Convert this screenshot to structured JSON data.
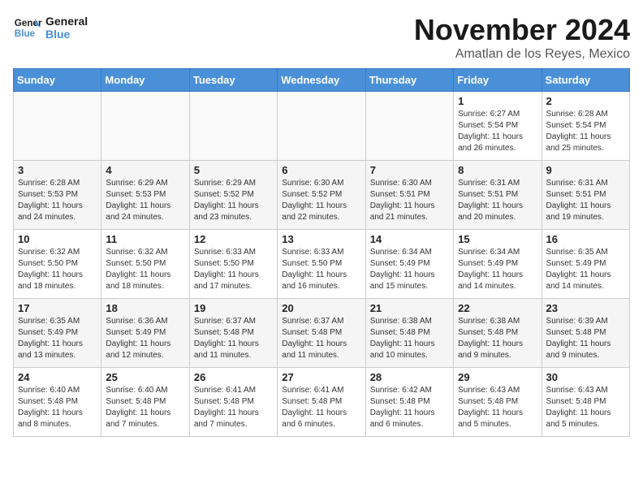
{
  "header": {
    "logo_line1": "General",
    "logo_line2": "Blue",
    "month": "November 2024",
    "location": "Amatlan de los Reyes, Mexico"
  },
  "days_of_week": [
    "Sunday",
    "Monday",
    "Tuesday",
    "Wednesday",
    "Thursday",
    "Friday",
    "Saturday"
  ],
  "weeks": [
    [
      {
        "num": "",
        "info": ""
      },
      {
        "num": "",
        "info": ""
      },
      {
        "num": "",
        "info": ""
      },
      {
        "num": "",
        "info": ""
      },
      {
        "num": "",
        "info": ""
      },
      {
        "num": "1",
        "info": "Sunrise: 6:27 AM\nSunset: 5:54 PM\nDaylight: 11 hours and 26 minutes."
      },
      {
        "num": "2",
        "info": "Sunrise: 6:28 AM\nSunset: 5:54 PM\nDaylight: 11 hours and 25 minutes."
      }
    ],
    [
      {
        "num": "3",
        "info": "Sunrise: 6:28 AM\nSunset: 5:53 PM\nDaylight: 11 hours and 24 minutes."
      },
      {
        "num": "4",
        "info": "Sunrise: 6:29 AM\nSunset: 5:53 PM\nDaylight: 11 hours and 24 minutes."
      },
      {
        "num": "5",
        "info": "Sunrise: 6:29 AM\nSunset: 5:52 PM\nDaylight: 11 hours and 23 minutes."
      },
      {
        "num": "6",
        "info": "Sunrise: 6:30 AM\nSunset: 5:52 PM\nDaylight: 11 hours and 22 minutes."
      },
      {
        "num": "7",
        "info": "Sunrise: 6:30 AM\nSunset: 5:51 PM\nDaylight: 11 hours and 21 minutes."
      },
      {
        "num": "8",
        "info": "Sunrise: 6:31 AM\nSunset: 5:51 PM\nDaylight: 11 hours and 20 minutes."
      },
      {
        "num": "9",
        "info": "Sunrise: 6:31 AM\nSunset: 5:51 PM\nDaylight: 11 hours and 19 minutes."
      }
    ],
    [
      {
        "num": "10",
        "info": "Sunrise: 6:32 AM\nSunset: 5:50 PM\nDaylight: 11 hours and 18 minutes."
      },
      {
        "num": "11",
        "info": "Sunrise: 6:32 AM\nSunset: 5:50 PM\nDaylight: 11 hours and 18 minutes."
      },
      {
        "num": "12",
        "info": "Sunrise: 6:33 AM\nSunset: 5:50 PM\nDaylight: 11 hours and 17 minutes."
      },
      {
        "num": "13",
        "info": "Sunrise: 6:33 AM\nSunset: 5:50 PM\nDaylight: 11 hours and 16 minutes."
      },
      {
        "num": "14",
        "info": "Sunrise: 6:34 AM\nSunset: 5:49 PM\nDaylight: 11 hours and 15 minutes."
      },
      {
        "num": "15",
        "info": "Sunrise: 6:34 AM\nSunset: 5:49 PM\nDaylight: 11 hours and 14 minutes."
      },
      {
        "num": "16",
        "info": "Sunrise: 6:35 AM\nSunset: 5:49 PM\nDaylight: 11 hours and 14 minutes."
      }
    ],
    [
      {
        "num": "17",
        "info": "Sunrise: 6:35 AM\nSunset: 5:49 PM\nDaylight: 11 hours and 13 minutes."
      },
      {
        "num": "18",
        "info": "Sunrise: 6:36 AM\nSunset: 5:49 PM\nDaylight: 11 hours and 12 minutes."
      },
      {
        "num": "19",
        "info": "Sunrise: 6:37 AM\nSunset: 5:48 PM\nDaylight: 11 hours and 11 minutes."
      },
      {
        "num": "20",
        "info": "Sunrise: 6:37 AM\nSunset: 5:48 PM\nDaylight: 11 hours and 11 minutes."
      },
      {
        "num": "21",
        "info": "Sunrise: 6:38 AM\nSunset: 5:48 PM\nDaylight: 11 hours and 10 minutes."
      },
      {
        "num": "22",
        "info": "Sunrise: 6:38 AM\nSunset: 5:48 PM\nDaylight: 11 hours and 9 minutes."
      },
      {
        "num": "23",
        "info": "Sunrise: 6:39 AM\nSunset: 5:48 PM\nDaylight: 11 hours and 9 minutes."
      }
    ],
    [
      {
        "num": "24",
        "info": "Sunrise: 6:40 AM\nSunset: 5:48 PM\nDaylight: 11 hours and 8 minutes."
      },
      {
        "num": "25",
        "info": "Sunrise: 6:40 AM\nSunset: 5:48 PM\nDaylight: 11 hours and 7 minutes."
      },
      {
        "num": "26",
        "info": "Sunrise: 6:41 AM\nSunset: 5:48 PM\nDaylight: 11 hours and 7 minutes."
      },
      {
        "num": "27",
        "info": "Sunrise: 6:41 AM\nSunset: 5:48 PM\nDaylight: 11 hours and 6 minutes."
      },
      {
        "num": "28",
        "info": "Sunrise: 6:42 AM\nSunset: 5:48 PM\nDaylight: 11 hours and 6 minutes."
      },
      {
        "num": "29",
        "info": "Sunrise: 6:43 AM\nSunset: 5:48 PM\nDaylight: 11 hours and 5 minutes."
      },
      {
        "num": "30",
        "info": "Sunrise: 6:43 AM\nSunset: 5:48 PM\nDaylight: 11 hours and 5 minutes."
      }
    ]
  ]
}
